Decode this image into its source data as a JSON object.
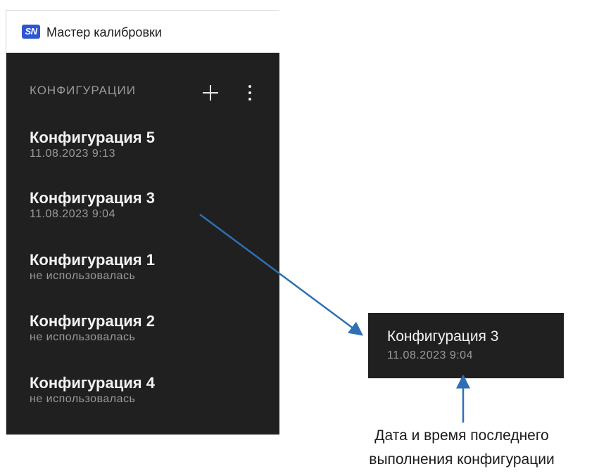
{
  "window": {
    "logo_text": "SN",
    "title": "Мастер калибровки"
  },
  "panel": {
    "header": "КОНФИГУРАЦИИ",
    "add_icon": "plus-icon",
    "more_icon": "more-vertical-icon",
    "items": [
      {
        "name": "Конфигурация 5",
        "subtitle": "11.08.2023 9:13"
      },
      {
        "name": "Конфигурация 3",
        "subtitle": "11.08.2023 9:04"
      },
      {
        "name": "Конфигурация 1",
        "subtitle": "не использовалась"
      },
      {
        "name": "Конфигурация 2",
        "subtitle": "не использовалась"
      },
      {
        "name": "Конфигурация 4",
        "subtitle": "не использовалась"
      }
    ]
  },
  "callout": {
    "name": "Конфигурация 3",
    "subtitle": "11.08.2023 9:04",
    "caption_line1": "Дата и время последнего",
    "caption_line2": "выполнения конфигурации"
  },
  "colors": {
    "panel_bg": "#202020",
    "arrow": "#2e6fb5",
    "logo": "#2f55d4"
  }
}
